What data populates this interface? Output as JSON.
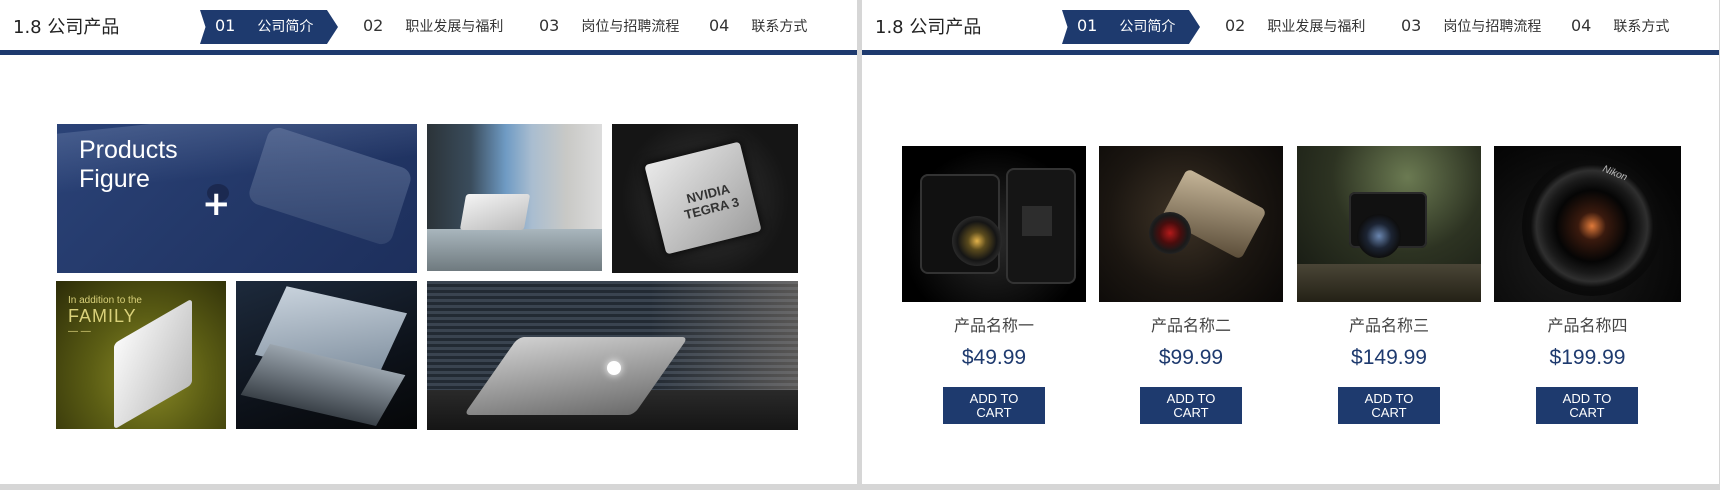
{
  "header": {
    "section_title": "1.8 公司产品",
    "tabs": [
      {
        "num": "01",
        "label": "公司简介",
        "active": true
      },
      {
        "num": "02",
        "label": "职业发展与福利",
        "active": false
      },
      {
        "num": "03",
        "label": "岗位与招聘流程",
        "active": false
      },
      {
        "num": "04",
        "label": "联系方式",
        "active": false
      }
    ]
  },
  "left": {
    "feature_title": "Products\nFigure",
    "feature_icon": "+",
    "chip_text": "NVIDIA\nTEGRA 3",
    "grass_caption_top": "In addition to the",
    "grass_caption_main": "FAMILY",
    "grass_caption_bottom": "— —"
  },
  "right": {
    "products": [
      {
        "name": "产品名称一",
        "price": "$49.99",
        "button": "ADD TO\nCART"
      },
      {
        "name": "产品名称二",
        "price": "$99.99",
        "button": "ADD TO\nCART"
      },
      {
        "name": "产品名称三",
        "price": "$149.99",
        "button": "ADD TO\nCART"
      },
      {
        "name": "产品名称四",
        "price": "$199.99",
        "button": "ADD TO\nCART"
      }
    ],
    "lens_brand": "Nikon"
  },
  "colors": {
    "accent": "#1e3a6e",
    "background": "#ffffff",
    "gutter": "#d6d6d6"
  }
}
